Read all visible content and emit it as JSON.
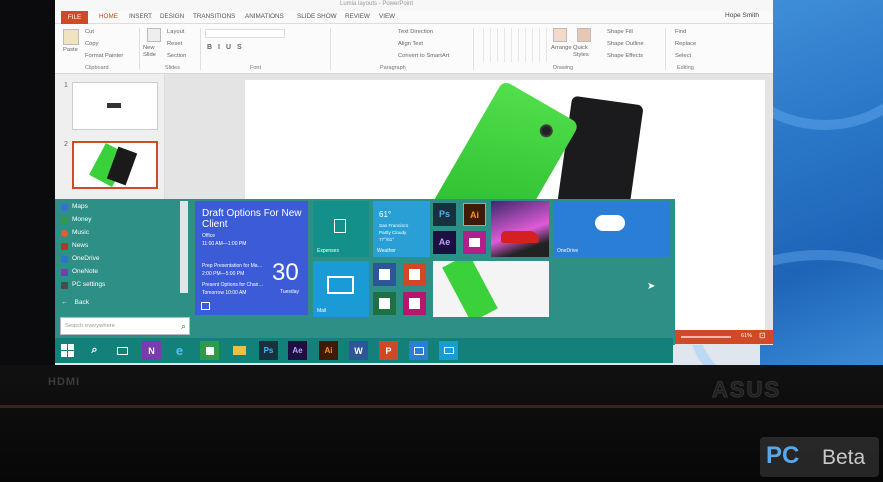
{
  "window": {
    "title": "Lumia layouts - PowerPoint",
    "user": "Hope Smith"
  },
  "ribbon_tabs": [
    "FILE",
    "HOME",
    "INSERT",
    "DESIGN",
    "TRANSITIONS",
    "ANIMATIONS",
    "SLIDE SHOW",
    "REVIEW",
    "VIEW"
  ],
  "ribbon": {
    "cut": "Cut",
    "copy": "Copy",
    "paste": "Paste",
    "format_painter": "Format Painter",
    "new_slide": "New Slide",
    "layout": "Layout",
    "reset": "Reset",
    "section": "Section",
    "text_direction": "Text Direction",
    "align_text": "Align Text",
    "convert_smartart": "Convert to SmartArt",
    "arrange": "Arrange",
    "quick_styles": "Quick Styles",
    "shape_fill": "Shape Fill",
    "shape_outline": "Shape Outline",
    "shape_effects": "Shape Effects",
    "find": "Find",
    "replace": "Replace",
    "select": "Select",
    "groups": [
      "Clipboard",
      "Slides",
      "Font",
      "Paragraph",
      "Drawing",
      "Editing"
    ]
  },
  "slides": [
    "1",
    "2"
  ],
  "status": {
    "zoom": "61%"
  },
  "start_menu": {
    "places": [
      {
        "label": "Maps",
        "color": "#3a6fd8"
      },
      {
        "label": "Money",
        "color": "#2f9a4a"
      },
      {
        "label": "Music",
        "color": "#e0602a"
      },
      {
        "label": "News",
        "color": "#b8342a"
      },
      {
        "label": "OneDrive",
        "color": "#2a74d0"
      },
      {
        "label": "OneNote",
        "color": "#7a3bb0"
      },
      {
        "label": "PC settings",
        "color": "#4a4a4a"
      }
    ],
    "back": "Back",
    "search_placeholder": "Search everywhere",
    "tiles": {
      "calendar_title": "Draft Options For New Client",
      "calendar_line1": "Office",
      "calendar_line2": "11:00 AM—1:00 PM",
      "calendar_line3": "Prep Presentation for Ma…",
      "calendar_line4": "2:00 PM—5:00 PM",
      "calendar_line5": "Present Options for Chari…",
      "calendar_line6": "Tomorrow 10:00 AM",
      "calendar_day": "30",
      "calendar_weekday": "Tuesday",
      "expenses_label": "Expenses",
      "weather_temp": "61°",
      "weather_city": "San Francisco",
      "weather_cond": "Partly Cloudy",
      "weather_range": "77°/61°",
      "weather_label": "Weather",
      "mail_label": "Mail",
      "onedrive_label": "OneDrive",
      "ps": "Ps",
      "ai": "Ai",
      "ae": "Ae"
    }
  },
  "taskbar": [
    "start-icon",
    "search-icon",
    "task-view-icon",
    "onenote-icon",
    "ie-icon",
    "store-icon",
    "explorer-icon",
    "Ps",
    "Ae",
    "Ai",
    "word-icon",
    "powerpoint-icon",
    "photos-icon",
    "mail-icon"
  ],
  "bezel": {
    "hdmi": "HDMI",
    "brand": "ASUS"
  },
  "watermark": {
    "logo": "PC",
    "text": "Beta"
  },
  "colors": {
    "accent": "#d04a27",
    "start_bg": "#2e8f86",
    "calendar": "#3b5cd6",
    "tile_blue": "#2a9fd6"
  }
}
